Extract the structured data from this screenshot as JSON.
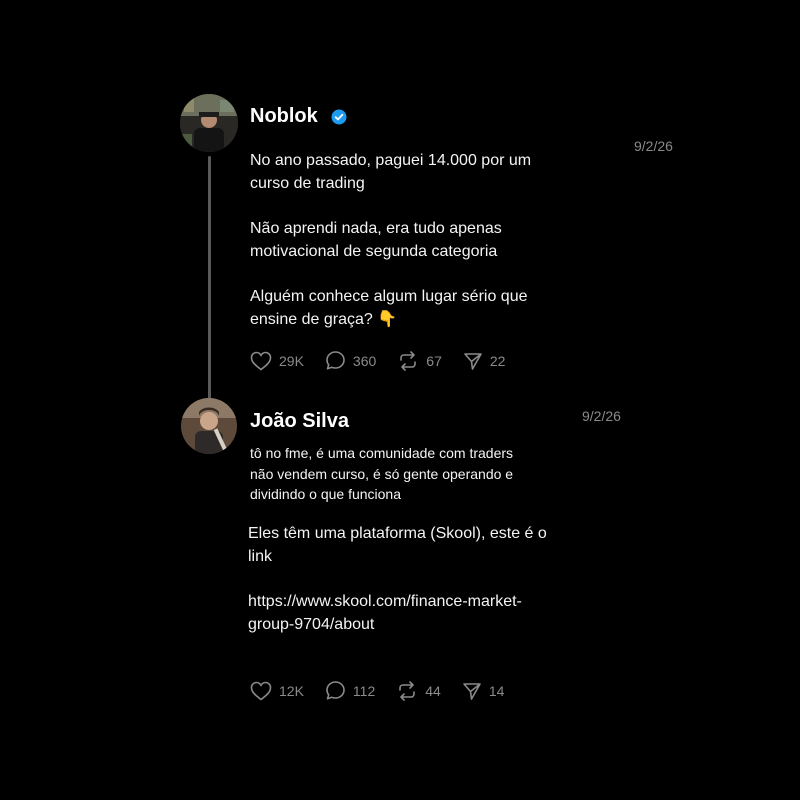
{
  "posts": [
    {
      "author": "Noblok",
      "verified": true,
      "date": "9/2/26",
      "paragraphs": [
        [
          "No ano passado, paguei 14.000 por um",
          "curso de trading"
        ],
        [
          "Não aprendi nada, era tudo apenas",
          "motivacional de segunda categoria"
        ],
        [
          "Alguém conhece algum lugar sério que",
          "ensine de graça? 👇"
        ]
      ],
      "stats": {
        "likes": "29K",
        "replies": "360",
        "reposts": "67",
        "shares": "22"
      }
    },
    {
      "author": "João Silva",
      "verified": false,
      "date": "9/2/26",
      "quote_lines": [
        "tô no fme, é uma comunidade com traders",
        "não vendem curso, é só gente operando e",
        "dividindo o que funciona"
      ],
      "paragraphs": [
        [
          "Eles têm uma plataforma (Skool), este é o",
          "link"
        ],
        [
          "https://www.skool.com/finance-market-",
          "group-9704/about"
        ]
      ],
      "stats": {
        "likes": "12K",
        "replies": "112",
        "reposts": "44",
        "shares": "14"
      }
    }
  ],
  "icons": {
    "like": "heart-icon",
    "reply": "comment-icon",
    "repost": "repost-icon",
    "share": "send-icon",
    "verified": "verified-badge-icon"
  },
  "colors": {
    "background": "#000000",
    "verified": "#1d9bf0",
    "muted": "#8a8a8a"
  }
}
